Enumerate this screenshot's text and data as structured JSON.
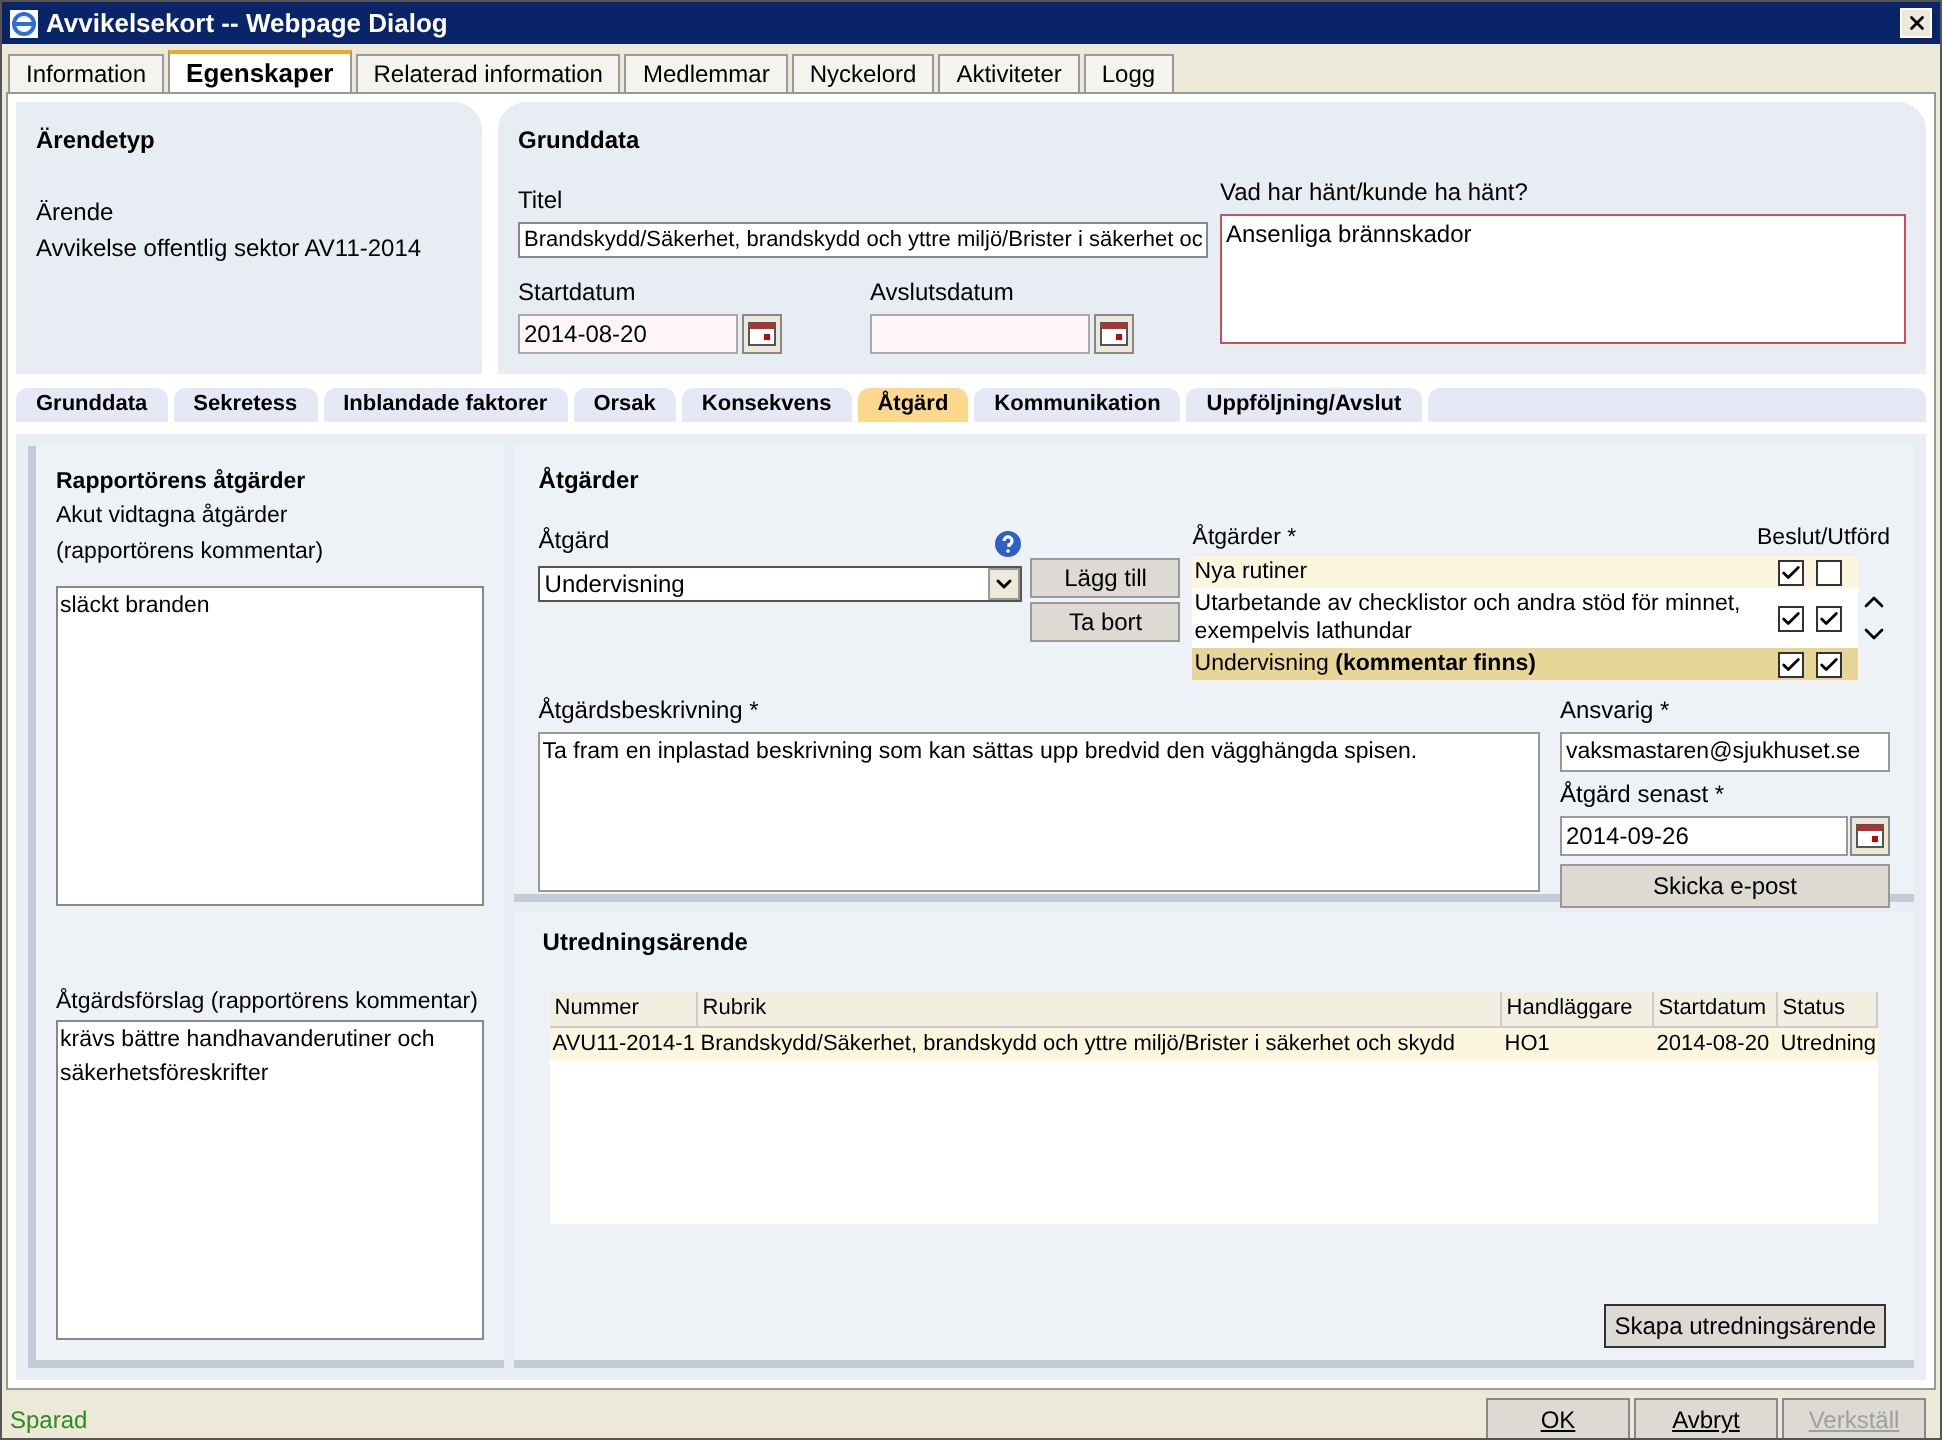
{
  "window": {
    "title": "Avvikelsekort -- Webpage Dialog"
  },
  "tabs": [
    {
      "label": "Information",
      "selected": false
    },
    {
      "label": "Egenskaper",
      "selected": true
    },
    {
      "label": "Relaterad information",
      "selected": false
    },
    {
      "label": "Medlemmar",
      "selected": false
    },
    {
      "label": "Nyckelord",
      "selected": false
    },
    {
      "label": "Aktiviteter",
      "selected": false
    },
    {
      "label": "Logg",
      "selected": false
    }
  ],
  "arendetyp": {
    "heading": "Ärendetyp",
    "lines": [
      "Ärende",
      "Avvikelse offentlig sektor AV11-2014"
    ]
  },
  "grunddata": {
    "heading": "Grunddata",
    "title_label": "Titel",
    "title_value": "Brandskydd/Säkerhet, brandskydd och yttre miljö/Brister i säkerhet oc",
    "start_label": "Startdatum",
    "start_value": "2014-08-20",
    "end_label": "Avslutsdatum",
    "what_label": "Vad har hänt/kunde ha hänt?",
    "what_value": "Ansenliga brännskador"
  },
  "subtabs": [
    {
      "label": "Grunddata",
      "selected": false
    },
    {
      "label": "Sekretess",
      "selected": false
    },
    {
      "label": "Inblandade faktorer",
      "selected": false
    },
    {
      "label": "Orsak",
      "selected": false
    },
    {
      "label": "Konsekvens",
      "selected": false
    },
    {
      "label": "Åtgärd",
      "selected": true
    },
    {
      "label": "Kommunikation",
      "selected": false
    },
    {
      "label": "Uppföljning/Avslut",
      "selected": false
    }
  ],
  "rapportor": {
    "heading": "Rapportörens åtgärder",
    "acute_label": "Akut vidtagna åtgärder (rapportörens kommentar)",
    "acute_value": "släckt branden",
    "proposal_label": "Åtgärdsförslag (rapportörens kommentar)",
    "proposal_value": "krävs bättre handhavanderutiner och säkerhetsföreskrifter"
  },
  "atgarder": {
    "heading": "Åtgärder",
    "atgard_label": "Åtgärd",
    "atgard_value": "Undervisning",
    "add_button": "Lägg till",
    "remove_button": "Ta bort",
    "list_label": "Åtgärder *",
    "columns_label": "Beslut/Utförd",
    "items": [
      {
        "text": "Nya rutiner",
        "beslut": true,
        "utford": false,
        "selected": false
      },
      {
        "text": "Utarbetande av checklistor och andra stöd för minnet, exempelvis lathundar",
        "beslut": true,
        "utford": true,
        "selected": false
      },
      {
        "text": "Undervisning **(kommentar finns)**",
        "beslut": true,
        "utford": true,
        "selected": true
      }
    ],
    "beskrivning_label": "Åtgärdsbeskrivning *",
    "beskrivning_value": "Ta fram en inplastad beskrivning som kan sättas upp bredvid den vägghängda spisen.",
    "ansvarig_label": "Ansvarig *",
    "ansvarig_value": "vaksmastaren@sjukhuset.se",
    "senast_label": "Åtgärd senast *",
    "senast_value": "2014-09-26",
    "email_button": "Skicka e-post"
  },
  "utredning": {
    "heading": "Utredningsärende",
    "columns": [
      "Nummer",
      "Rubrik",
      "Handläggare",
      "Startdatum",
      "Status"
    ],
    "rows": [
      {
        "cells": [
          "AVU11-2014-1",
          "Brandskydd/Säkerhet, brandskydd och yttre miljö/Brister i säkerhet och skydd",
          "HO1",
          "2014-08-20",
          "Utredning"
        ],
        "selected": true
      }
    ],
    "create_button": "Skapa utredningsärende"
  },
  "status_bar": {
    "text": "Sparad"
  },
  "buttons": [
    {
      "label": "OK",
      "disabled": false
    },
    {
      "label": "Avbryt",
      "disabled": false
    },
    {
      "label": "Verkställ",
      "disabled": true
    }
  ]
}
